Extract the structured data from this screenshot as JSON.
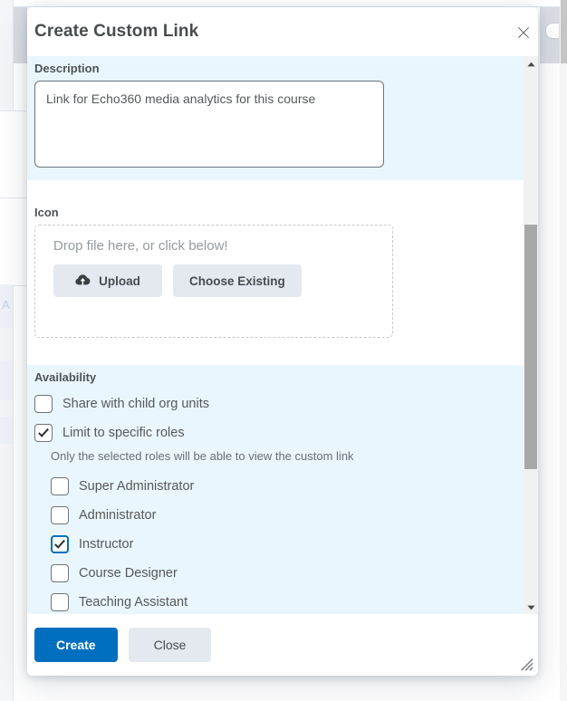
{
  "dialog": {
    "title": "Create Custom Link",
    "close_icon": "close-icon",
    "description": {
      "label": "Description",
      "value": "Link for Echo360 media analytics for this course",
      "placeholder": ""
    },
    "icon_section": {
      "label": "Icon",
      "dropzone_text": "Drop file here, or click below!",
      "upload_label": "Upload",
      "upload_icon": "cloud-upload-icon",
      "choose_existing_label": "Choose Existing"
    },
    "availability": {
      "label": "Availability",
      "share_with_child_org_units": {
        "label": "Share with child org units",
        "checked": false
      },
      "limit_to_specific_roles": {
        "label": "Limit to specific roles",
        "checked": true
      },
      "helper_text": "Only the selected roles will be able to view the custom link",
      "roles": [
        {
          "label": "Super Administrator",
          "checked": false,
          "focused": false
        },
        {
          "label": "Administrator",
          "checked": false,
          "focused": false
        },
        {
          "label": "Instructor",
          "checked": true,
          "focused": true
        },
        {
          "label": "Course Designer",
          "checked": false,
          "focused": false
        },
        {
          "label": "Teaching Assistant",
          "checked": false,
          "focused": false
        }
      ]
    },
    "footer": {
      "create_label": "Create",
      "close_label": "Close",
      "resize_icon": "resize-grip-icon"
    },
    "scrollbar": {
      "up_icon": "scroll-up-arrow-icon",
      "down_icon": "scroll-down-arrow-icon"
    }
  },
  "background": {
    "ghost_text": "A"
  },
  "colors": {
    "accent": "#006fbf",
    "highlight_section": "#e9f6fd",
    "button_gray": "#e3e9ef",
    "text": "#494c4e",
    "muted_text": "#6b6f72"
  }
}
